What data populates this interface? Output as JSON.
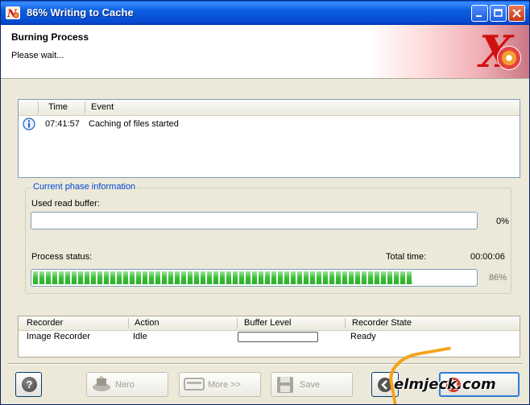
{
  "window": {
    "title": "86% Writing to Cache"
  },
  "header": {
    "title": "Burning Process",
    "subtitle": "Please wait..."
  },
  "event_list": {
    "columns": [
      "Time",
      "Event"
    ],
    "rows": [
      {
        "time": "07:41:57",
        "event": "Caching of files started",
        "icon": "info-icon"
      }
    ]
  },
  "phase": {
    "legend": "Current phase information",
    "read_buffer_label": "Used read buffer:",
    "read_buffer_percent": "0%",
    "read_buffer_value": 0,
    "process_status_label": "Process status:",
    "total_time_label": "Total time:",
    "total_time_value": "00:00:06",
    "process_percent": "86%",
    "process_value": 86
  },
  "recorder_table": {
    "columns": [
      "Recorder",
      "Action",
      "Buffer Level",
      "Recorder State"
    ],
    "rows": [
      {
        "recorder": "Image Recorder",
        "action": "Idle",
        "state": "Ready"
      }
    ]
  },
  "buttons": {
    "nero": "Nero",
    "more": "More >>",
    "save": "Save"
  },
  "watermark": {
    "text": "elmjeck.com"
  },
  "colors": {
    "title_bar": "#0b5fe0",
    "progress": "#37c034",
    "legend_text": "#0046d5"
  }
}
